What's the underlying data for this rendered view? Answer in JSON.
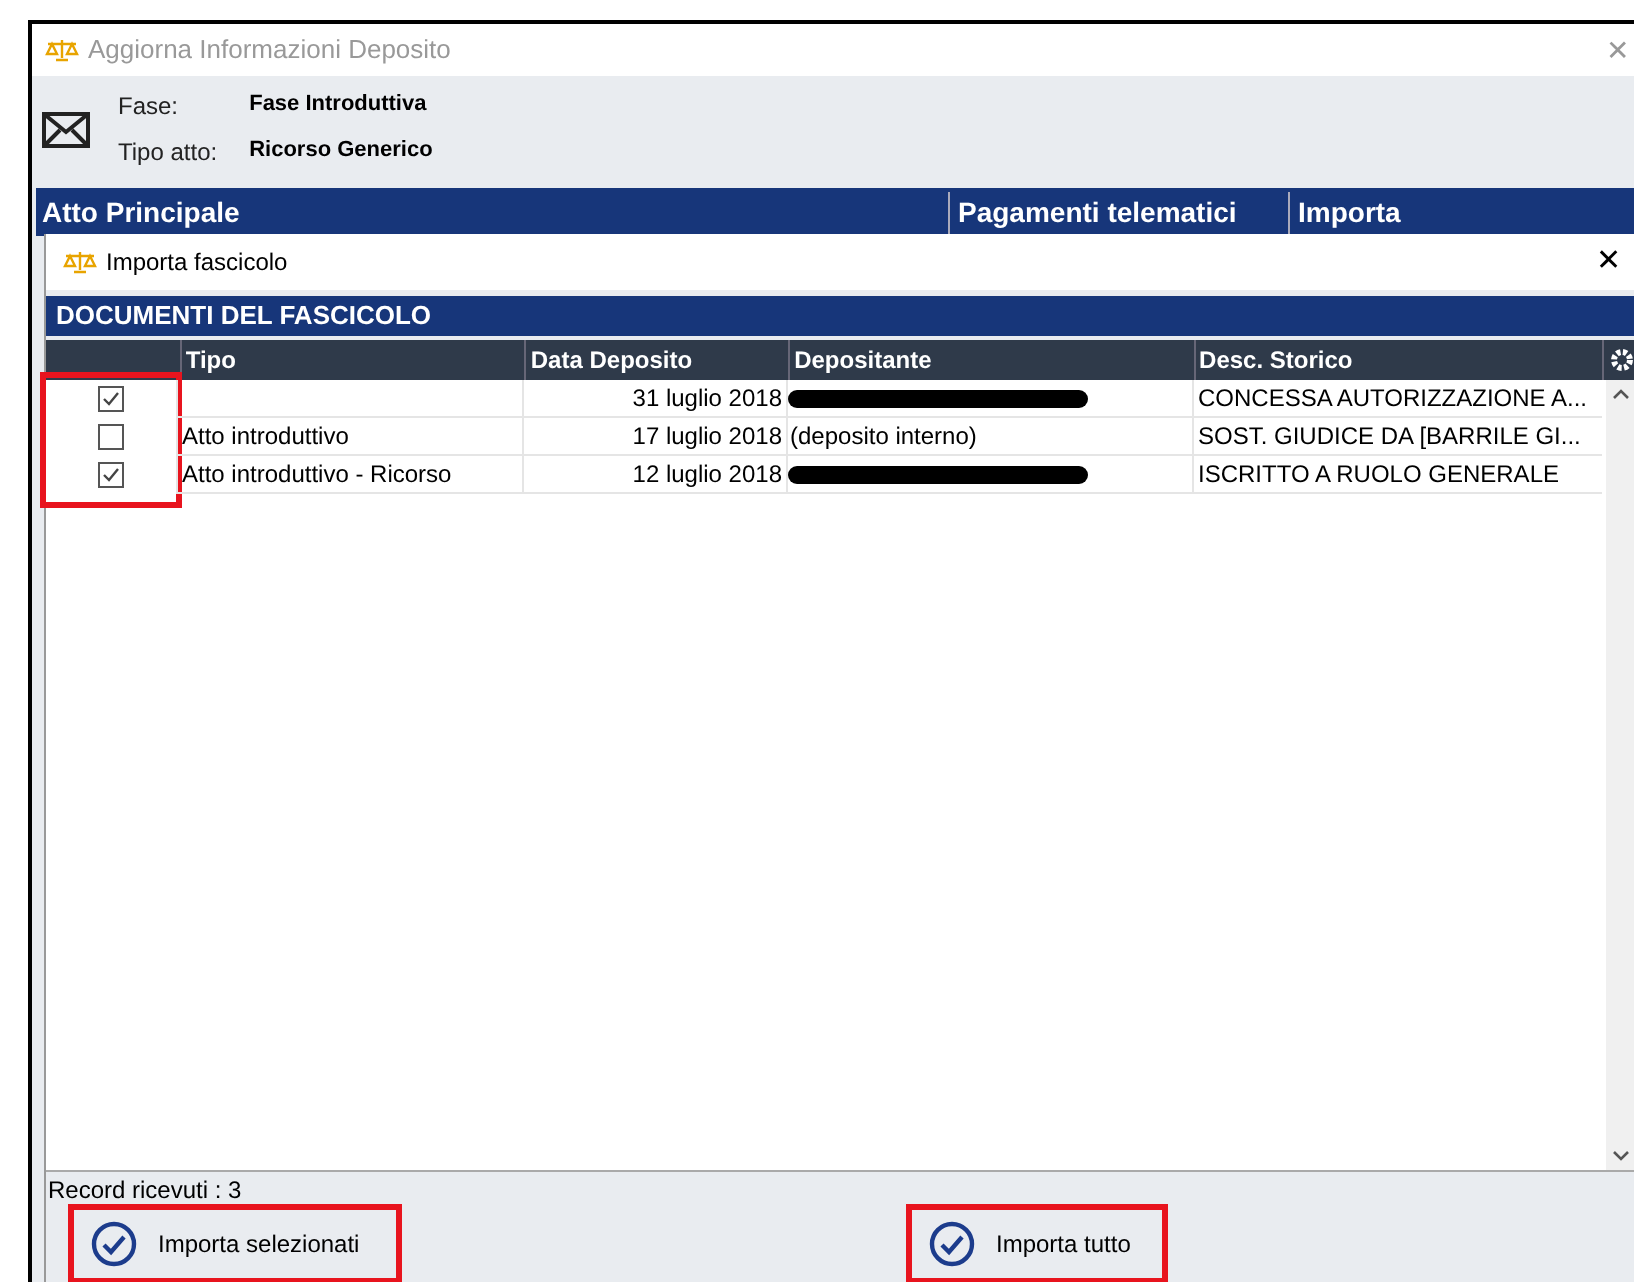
{
  "window": {
    "title": "Aggiorna Informazioni Deposito",
    "close": "✕"
  },
  "info": [
    {
      "label": "Fase:",
      "value": "Fase Introduttiva"
    },
    {
      "label": "Tipo atto:",
      "value": "Ricorso Generico"
    }
  ],
  "bar_columns": [
    "Atto Principale",
    "Pagamenti telematici",
    "Importa"
  ],
  "dialog": {
    "title": "Importa fascicolo",
    "close": "✕",
    "section": "DOCUMENTI DEL FASCICOLO",
    "columns": [
      "Tipo",
      "Data Deposito",
      "Depositante",
      "Desc. Storico"
    ],
    "checkbox_column_highlighted": true,
    "rows": [
      {
        "checked": true,
        "tipo": "",
        "data": "31 luglio 2018",
        "depositante": "",
        "depositante_redacted": true,
        "desc": "CONCESSA AUTORIZZAZIONE A..."
      },
      {
        "checked": false,
        "tipo": "Atto introduttivo",
        "data": "17 luglio 2018",
        "depositante": "(deposito interno)",
        "depositante_redacted": false,
        "desc": "SOST. GIUDICE DA [BARRILE GI..."
      },
      {
        "checked": true,
        "tipo": "Atto introduttivo - Ricorso",
        "data": "12 luglio 2018",
        "depositante": "",
        "depositante_redacted": true,
        "desc": "ISCRITTO A RUOLO GENERALE"
      }
    ],
    "status": "Record ricevuti : 3",
    "buttons": [
      {
        "label": "Importa selezionati",
        "highlighted": true
      },
      {
        "label": "Importa tutto",
        "highlighted": true
      }
    ]
  }
}
